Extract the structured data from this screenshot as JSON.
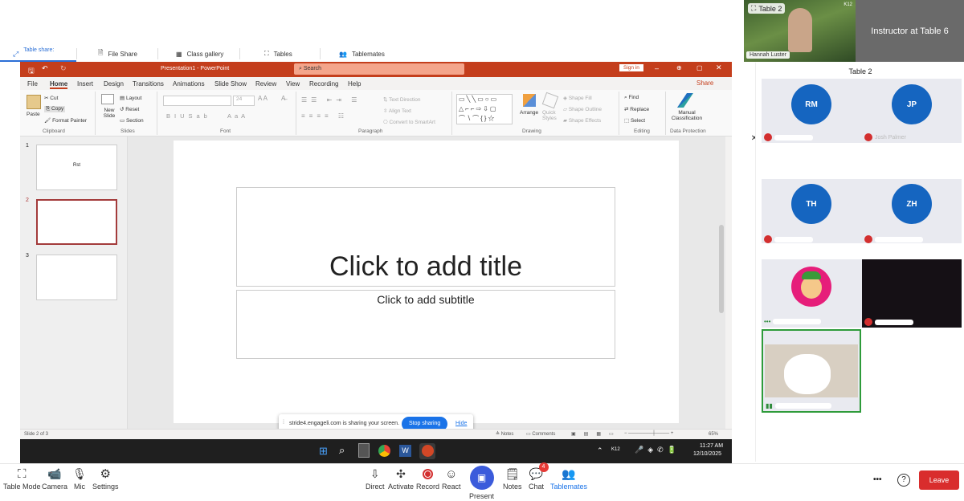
{
  "tabs": {
    "table_share": "Table share:",
    "file_share": "File Share",
    "class_gallery": "Class gallery",
    "tables": "Tables",
    "tablemates": "Tablemates"
  },
  "self_video": {
    "badge": "Table 2",
    "name": "Hannah Luster",
    "corner": "K12"
  },
  "instructor": {
    "label": "Instructor at Table 6"
  },
  "ppt": {
    "title": "Presentation1 - PowerPoint",
    "search": "Search",
    "sign_in": "Sign in",
    "share": "Share",
    "tabs": [
      "File",
      "Home",
      "Insert",
      "Design",
      "Transitions",
      "Animations",
      "Slide Show",
      "Review",
      "View",
      "Recording",
      "Help"
    ],
    "ribbon": {
      "paste": "Paste",
      "cut": "Cut",
      "copy": "Copy",
      "format_painter": "Format Painter",
      "clipboard": "Clipboard",
      "new_slide": "New Slide",
      "layout": "Layout",
      "reset": "Reset",
      "section": "Section",
      "slides": "Slides",
      "font": "Font",
      "paragraph": "Paragraph",
      "text_direction": "Text Direction",
      "align_text": "Align Text",
      "convert_smartart": "Convert to SmartArt",
      "arrange": "Arrange",
      "quick_styles": "Quick Styles",
      "shape_fill": "Shape Fill",
      "shape_outline": "Shape Outline",
      "shape_effects": "Shape Effects",
      "drawing": "Drawing",
      "find": "Find",
      "replace": "Replace",
      "select": "Select",
      "editing": "Editing",
      "manual_classification": "Manual Classification",
      "data_protection": "Data Protection",
      "font_size": "24"
    },
    "thumbs": [
      {
        "num": "1",
        "text": "Rst"
      },
      {
        "num": "2",
        "text": ""
      },
      {
        "num": "3",
        "text": ""
      }
    ],
    "slide": {
      "title": "Click to add title",
      "subtitle": "Click to add subtitle"
    },
    "share_banner": {
      "text": "stride4.engageli.com is sharing your screen.",
      "stop": "Stop sharing",
      "hide": "Hide"
    },
    "status": {
      "slide_info": "Slide 2 of 3",
      "notes": "Notes",
      "comments": "Comments",
      "zoom": "65%"
    }
  },
  "taskbar": {
    "time": "11:27 AM",
    "date": "12/10/2025",
    "tray": "K12"
  },
  "panel": {
    "title": "Table 2",
    "participants": [
      {
        "initials": "RM",
        "name": ""
      },
      {
        "initials": "JP",
        "name": "Josh Palmer"
      },
      {
        "initials": "TH",
        "name": ""
      },
      {
        "initials": "ZH",
        "name": ""
      }
    ]
  },
  "bottom": {
    "table_mode": "Table Mode",
    "camera": "Camera",
    "mic": "Mic",
    "settings": "Settings",
    "direct": "Direct",
    "activate": "Activate",
    "record": "Record",
    "react": "React",
    "present": "Present",
    "notes": "Notes",
    "chat": "Chat",
    "chat_badge": "4",
    "tablemates": "Tablemates",
    "more": "•••",
    "help": "?",
    "leave": "Leave"
  },
  "colors": {
    "ppt_red": "#c43e1c",
    "accent": "#2b6fd6",
    "present": "#3b5bdb",
    "leave": "#d92d2d",
    "avatar": "#1565c0"
  }
}
